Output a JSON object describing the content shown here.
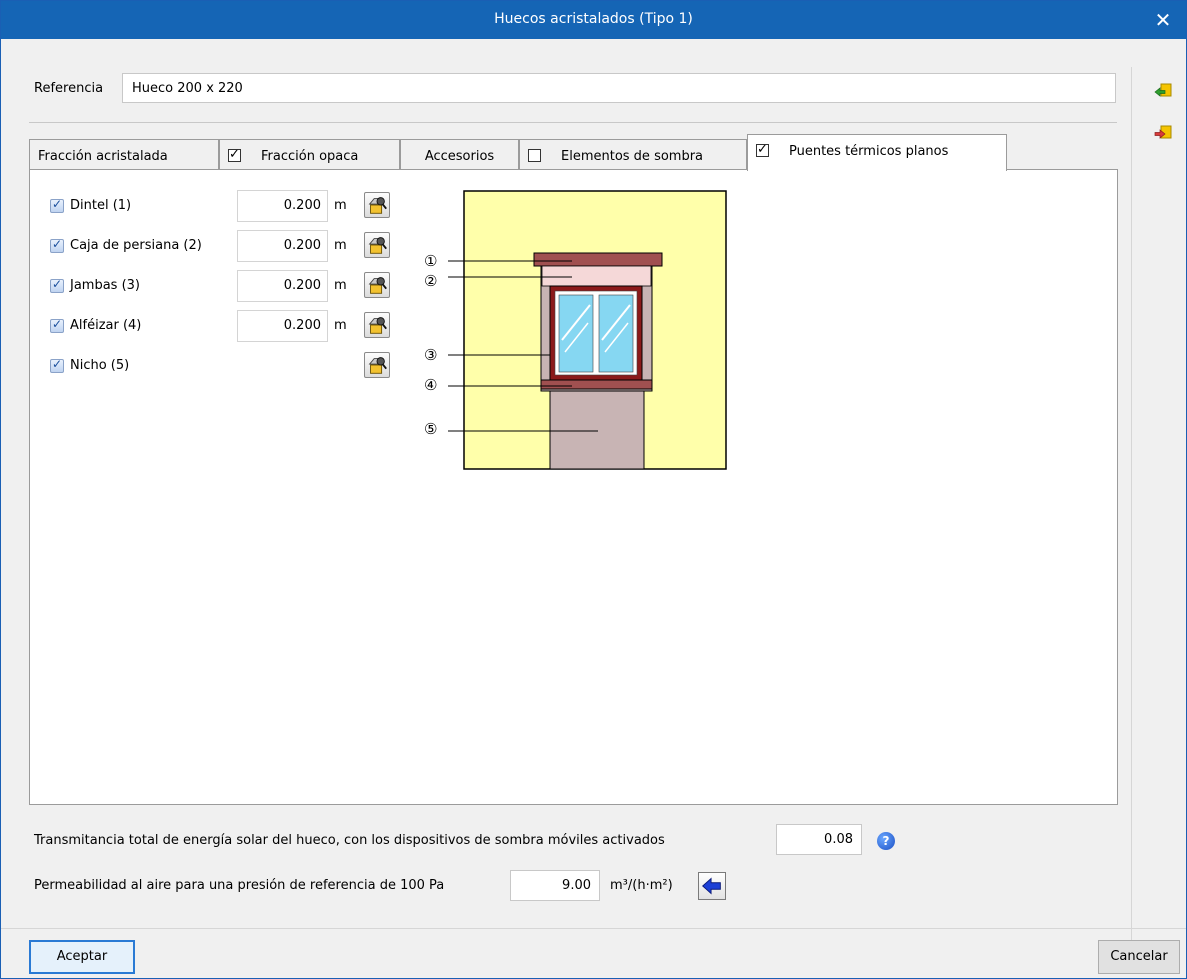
{
  "window": {
    "title": "Huecos acristalados (Tipo 1)"
  },
  "reference": {
    "label": "Referencia",
    "value": "Hueco 200 x 220"
  },
  "tabs": [
    {
      "label": "Fracción acristalada",
      "has_checkbox": false,
      "checked": false,
      "active": false
    },
    {
      "label": "Fracción opaca",
      "has_checkbox": true,
      "checked": true,
      "active": false
    },
    {
      "label": "Accesorios",
      "has_checkbox": false,
      "checked": false,
      "active": false
    },
    {
      "label": "Elementos de sombra",
      "has_checkbox": true,
      "checked": false,
      "active": false
    },
    {
      "label": "Puentes térmicos planos",
      "has_checkbox": true,
      "checked": true,
      "active": true
    }
  ],
  "bridges": [
    {
      "label": "Dintel (1)",
      "checked": true,
      "value": "0.200",
      "unit": "m"
    },
    {
      "label": "Caja de persiana (2)",
      "checked": true,
      "value": "0.200",
      "unit": "m"
    },
    {
      "label": "Jambas (3)",
      "checked": true,
      "value": "0.200",
      "unit": "m"
    },
    {
      "label": "Alféizar (4)",
      "checked": true,
      "value": "0.200",
      "unit": "m"
    },
    {
      "label": "Nicho (5)",
      "checked": true
    }
  ],
  "diagram": {
    "markers": [
      "①",
      "②",
      "③",
      "④",
      "⑤"
    ]
  },
  "transmittance": {
    "label": "Transmitancia total de energía solar del hueco, con los dispositivos de sombra móviles activados",
    "value": "0.08"
  },
  "permeability": {
    "label": "Permeabilidad al aire para una presión de referencia de 100 Pa",
    "value": "9.00",
    "unit": "m³/(h·m²)"
  },
  "buttons": {
    "accept": "Aceptar",
    "cancel": "Cancelar"
  },
  "icons": {
    "help": "?",
    "close": "✕"
  },
  "colors": {
    "titlebar": "#1565b5",
    "wall": "#ffffaa",
    "niche": "#c8b4b4",
    "lintel": "#a05050",
    "frame": "#8b1a1a",
    "glass": "#86d7f2"
  }
}
